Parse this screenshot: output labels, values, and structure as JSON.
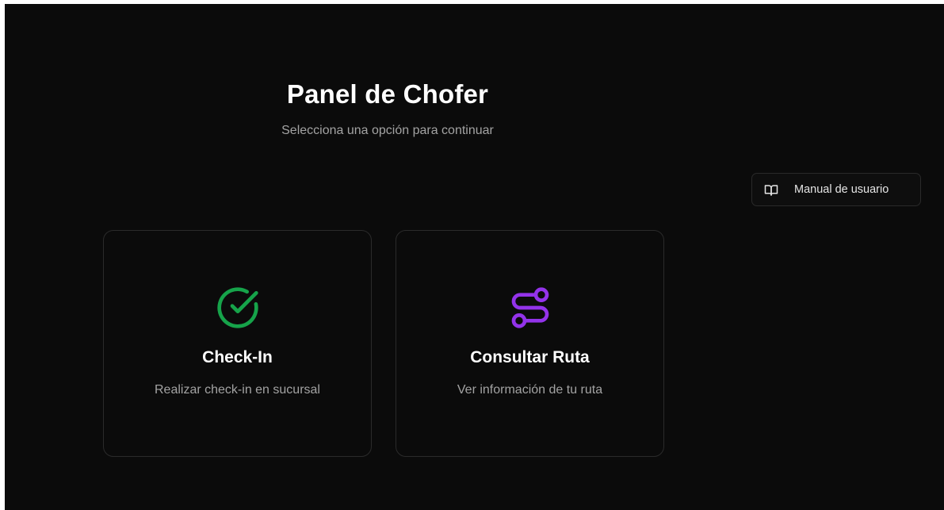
{
  "header": {
    "title": "Panel de Chofer",
    "subtitle": "Selecciona una opción para continuar"
  },
  "manual": {
    "label": "Manual de usuario",
    "icon": "book-open-icon"
  },
  "cards": [
    {
      "title": "Check-In",
      "description": "Realizar check-in en sucursal",
      "icon": "check-circle-icon",
      "color": "#16a34a"
    },
    {
      "title": "Consultar Ruta",
      "description": "Ver información de tu ruta",
      "icon": "route-icon",
      "color": "#9333ea"
    }
  ],
  "colors": {
    "background": "#0b0b0b",
    "border": "#2b2b2b",
    "text_primary": "#ffffff",
    "text_muted": "#a3a3a3"
  }
}
